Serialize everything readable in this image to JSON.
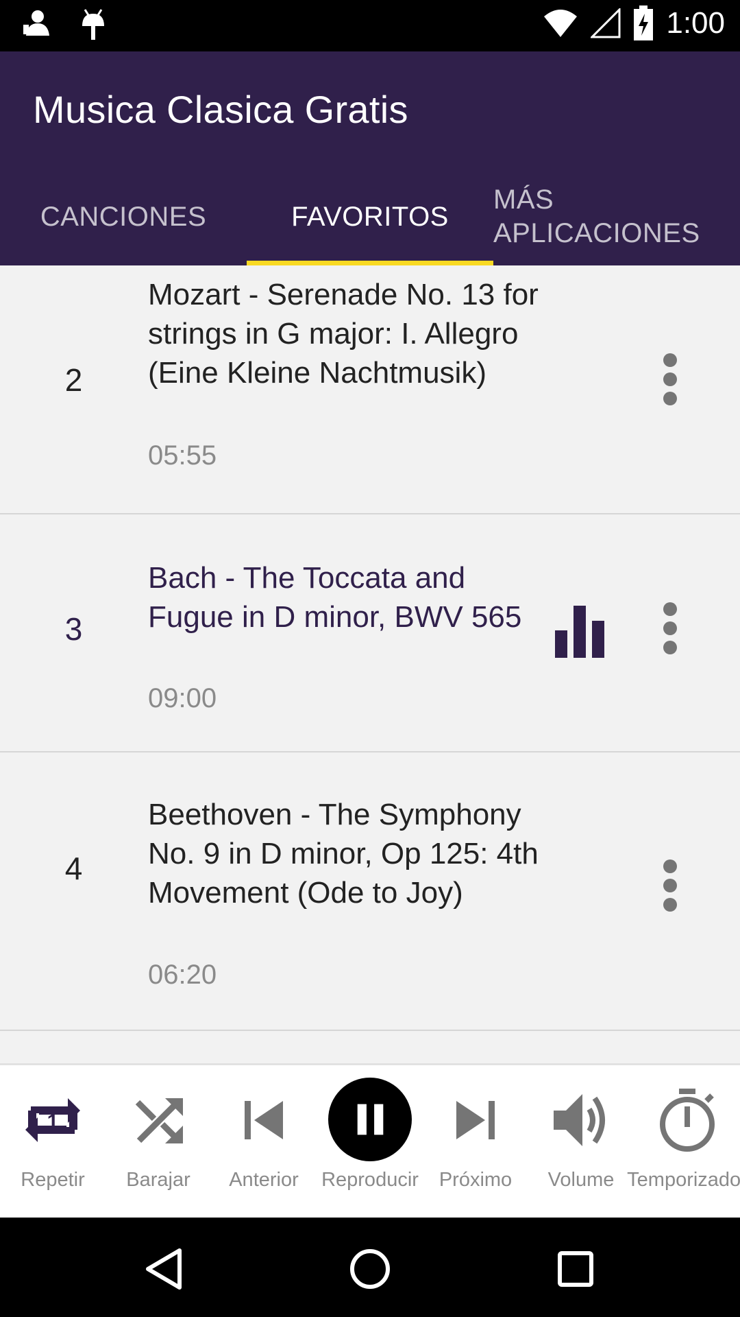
{
  "status_bar": {
    "time": "1:00"
  },
  "app": {
    "title": "Musica Clasica Gratis",
    "accent_color": "#30204b",
    "indicator_color": "#f9d923"
  },
  "tabs": [
    {
      "label": "CANCIONES",
      "active": false
    },
    {
      "label": "FAVORITOS",
      "active": true
    },
    {
      "label": "MÁS APLICACIONES",
      "active": false
    }
  ],
  "songs": [
    {
      "number": "2",
      "title": "Mozart - Serenade No. 13 for strings in G major: I. Allegro (Eine Kleine Nachtmusik)",
      "duration": "05:55",
      "playing": false
    },
    {
      "number": "3",
      "title": "Bach - The Toccata and Fugue in D minor, BWV 565",
      "duration": "09:00",
      "playing": true
    },
    {
      "number": "4",
      "title": "Beethoven - The Symphony No. 9 in D minor, Op 125: 4th Movement (Ode to Joy)",
      "duration": "06:20",
      "playing": false
    }
  ],
  "player": {
    "repeat": {
      "label": "Repetir",
      "icon": "repeat-one-icon"
    },
    "shuffle": {
      "label": "Barajar",
      "icon": "shuffle-icon"
    },
    "previous": {
      "label": "Anterior",
      "icon": "skip-previous-icon"
    },
    "play": {
      "label": "Reproducir",
      "icon": "pause-icon"
    },
    "next": {
      "label": "Próximo",
      "icon": "skip-next-icon"
    },
    "volume": {
      "label": "Volume",
      "icon": "volume-icon"
    },
    "timer": {
      "label": "Temporizador",
      "icon": "timer-icon"
    }
  }
}
